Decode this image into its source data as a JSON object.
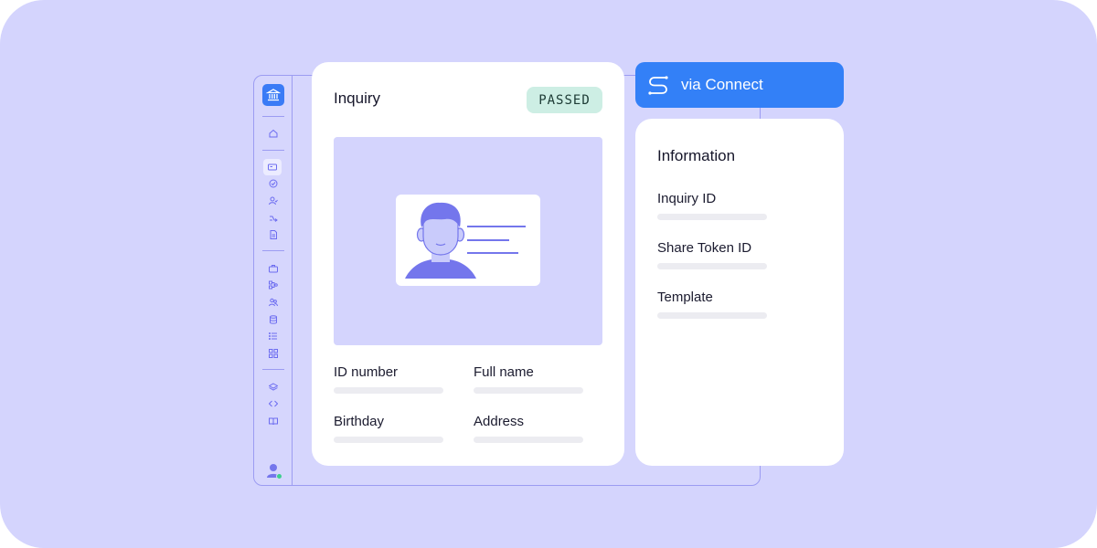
{
  "inquiry_card": {
    "title": "Inquiry",
    "status": "PASSED",
    "fields": [
      {
        "label": "ID number"
      },
      {
        "label": "Full name"
      },
      {
        "label": "Birthday"
      },
      {
        "label": "Address"
      }
    ]
  },
  "connect": {
    "label": "via Connect"
  },
  "info_card": {
    "title": "Information",
    "fields": [
      {
        "label": "Inquiry ID"
      },
      {
        "label": "Share Token ID"
      },
      {
        "label": "Template"
      }
    ]
  },
  "sidebar": {
    "logo_icon": "bank-icon",
    "items": [
      {
        "icon": "home-icon"
      },
      {
        "icon": "id-card-icon",
        "active": true
      },
      {
        "icon": "check-circle-icon"
      },
      {
        "icon": "user-check-icon"
      },
      {
        "icon": "workflow-icon"
      },
      {
        "icon": "document-icon"
      },
      {
        "icon": "briefcase-icon"
      },
      {
        "icon": "flow-icon"
      },
      {
        "icon": "users-icon"
      },
      {
        "icon": "database-icon"
      },
      {
        "icon": "list-icon"
      },
      {
        "icon": "grid-icon"
      },
      {
        "icon": "layers-icon"
      },
      {
        "icon": "code-icon"
      },
      {
        "icon": "book-icon"
      }
    ],
    "user_icon": "user-avatar-icon"
  },
  "colors": {
    "background": "#d4d4fd",
    "accent": "#3380f7",
    "badge_bg": "#cdeee4",
    "outline": "#9c9cf2",
    "avatar": "#7476ec"
  }
}
